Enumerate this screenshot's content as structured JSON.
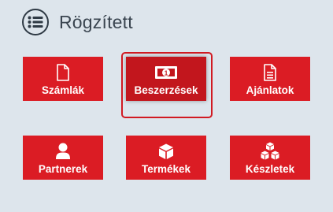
{
  "header": {
    "title": "Rögzített",
    "icon": "list-circle-icon"
  },
  "tiles": [
    {
      "label": "Számlák",
      "icon": "document-icon"
    },
    {
      "label": "Beszerzések",
      "icon": "banknote-icon",
      "selected": true
    },
    {
      "label": "Ajánlatok",
      "icon": "text-document-icon"
    },
    {
      "label": "Partnerek",
      "icon": "user-icon"
    },
    {
      "label": "Termékek",
      "icon": "box-icon"
    },
    {
      "label": "Készletek",
      "icon": "boxes-icon"
    }
  ],
  "colors": {
    "tile": "#db1c24",
    "background": "#dde5ec",
    "text_dark": "#3a4550"
  }
}
